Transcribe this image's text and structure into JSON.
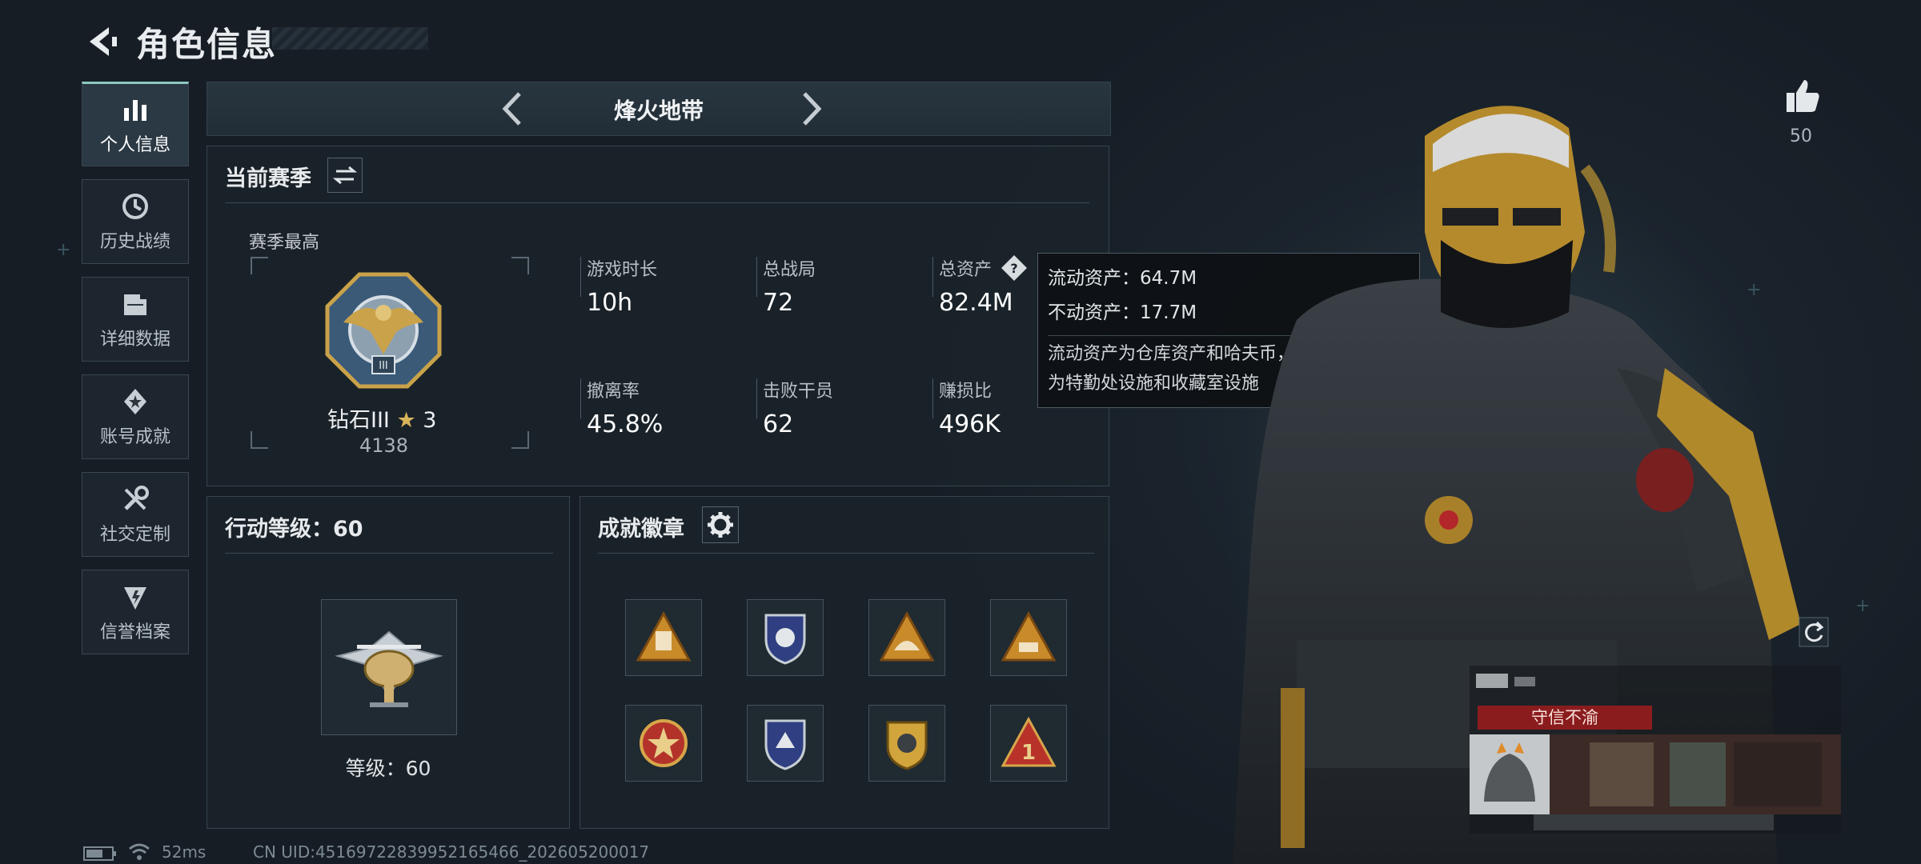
{
  "header": {
    "title": "角色信息"
  },
  "sidebar": {
    "items": [
      {
        "label": "个人信息",
        "icon": "bar-chart-icon",
        "active": true
      },
      {
        "label": "历史战绩",
        "icon": "history-icon",
        "active": false
      },
      {
        "label": "详细数据",
        "icon": "folder-icon",
        "active": false
      },
      {
        "label": "账号成就",
        "icon": "achievement-icon",
        "active": false
      },
      {
        "label": "社交定制",
        "icon": "wrench-icon",
        "active": false
      },
      {
        "label": "信誉档案",
        "icon": "reputation-icon",
        "active": false
      }
    ]
  },
  "tabbar": {
    "label": "烽火地带"
  },
  "season": {
    "title": "当前赛季",
    "best_label": "赛季最高",
    "rank_name": "钻石III",
    "rank_stars": "3",
    "rank_score": "4138",
    "stats": [
      {
        "label": "游戏时长",
        "value": "10h"
      },
      {
        "label": "总战局",
        "value": "72"
      },
      {
        "label": "总资产",
        "value": "82.4M"
      },
      {
        "label": "撤离率",
        "value": "45.8%"
      },
      {
        "label": "击败干员",
        "value": "62"
      },
      {
        "label": "赚损比",
        "value": "496K"
      }
    ]
  },
  "tooltip": {
    "line1": "流动资产：64.7M",
    "line2": "不动资产：17.7M",
    "desc1": "流动资产为仓库资产和哈夫币，不动资产",
    "desc2": "为特勤处设施和收藏室设施"
  },
  "level": {
    "title": "行动等级：60",
    "label": "等级：60"
  },
  "achievements": {
    "title": "成就徽章",
    "badges": [
      "triangle-badge-icon",
      "shield-badge-icon",
      "triangle-badge-icon",
      "triangle-badge-icon",
      "star-badge-icon",
      "shield-badge-icon",
      "wing-badge-icon",
      "triangle-badge-icon"
    ]
  },
  "right": {
    "likes": "50",
    "credit_tag": "守信不渝"
  },
  "footer": {
    "ping": "52ms",
    "uid": "CN UID:45169722839952165466_202605200017"
  },
  "colors": {
    "accent": "#8ec9c2",
    "gold": "#c9a24a",
    "credit_red": "#8b1c1e"
  }
}
